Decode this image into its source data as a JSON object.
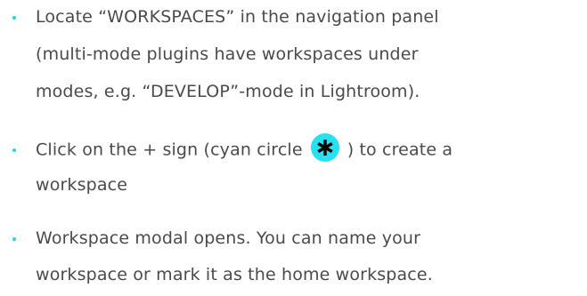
{
  "colors": {
    "bullet": "#2fd0e0",
    "icon_circle": "#27e0f0",
    "icon_glyph": "#000000",
    "text": "#4a4a4a"
  },
  "steps": [
    {
      "lines": [
        "Locate “WORKSPACES” in the navigation panel",
        "(multi-mode plugins have workspaces under",
        "modes, e.g. “DEVELOP”-mode in Lightroom)."
      ]
    },
    {
      "line1_before": "Click on the + sign (cyan circle",
      "icon": "asterisk-icon",
      "line1_after": ") to create a",
      "line2": "workspace"
    },
    {
      "lines": [
        "Workspace modal opens. You can name your",
        "workspace or mark it as the home workspace."
      ]
    }
  ]
}
